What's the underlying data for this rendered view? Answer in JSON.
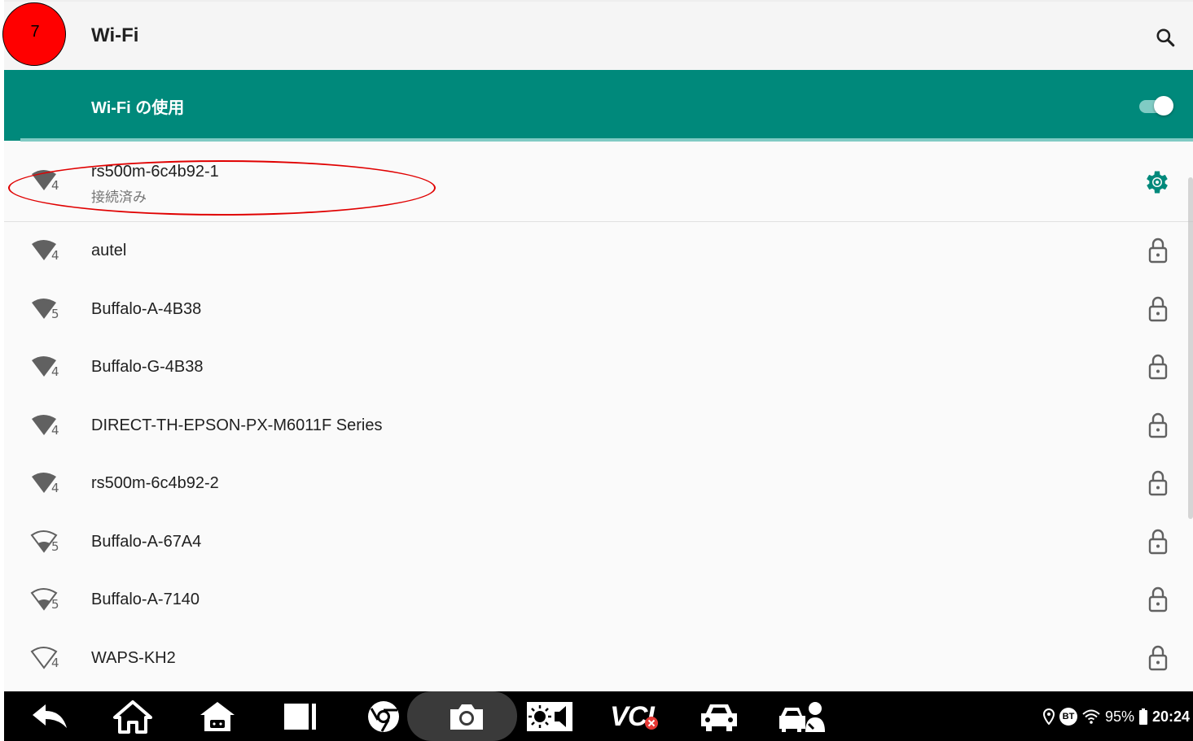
{
  "annotation": {
    "step_number": "7"
  },
  "appbar": {
    "title": "Wi-Fi",
    "search_icon": "search-icon"
  },
  "master_switch": {
    "label": "Wi-Fi の使用",
    "on": true
  },
  "colors": {
    "accent": "#00897b",
    "toggle_track": "#80cbc4",
    "annotation_red": "#ff0000"
  },
  "connected_network": {
    "ssid": "rs500m-6c4b92-1",
    "status": "接続済み",
    "signal_icon": "wifi-full-icon",
    "band": "4",
    "action_icon": "gear-icon"
  },
  "networks": [
    {
      "ssid": "autel",
      "band": "4",
      "signal": "full",
      "secured": true
    },
    {
      "ssid": "Buffalo-A-4B38",
      "band": "5",
      "signal": "full",
      "secured": true
    },
    {
      "ssid": "Buffalo-G-4B38",
      "band": "4",
      "signal": "full",
      "secured": true
    },
    {
      "ssid": "DIRECT-TH-EPSON-PX-M6011F Series",
      "band": "4",
      "signal": "full",
      "secured": true
    },
    {
      "ssid": "rs500m-6c4b92-2",
      "band": "4",
      "signal": "full",
      "secured": true
    },
    {
      "ssid": "Buffalo-A-67A4",
      "band": "5",
      "signal": "low",
      "secured": true
    },
    {
      "ssid": "Buffalo-A-7140",
      "band": "5",
      "signal": "low",
      "secured": true
    },
    {
      "ssid": "WAPS-KH2",
      "band": "4",
      "signal": "none",
      "secured": true
    }
  ],
  "navbar": {
    "items": [
      "back-icon",
      "home-icon",
      "android-home-icon",
      "recents-icon",
      "chrome-icon",
      "camera-icon",
      "brightness-icon",
      "vci-icon",
      "car-icon",
      "car-service-icon"
    ],
    "vci_label": "VCI"
  },
  "status_bar": {
    "location_icon": "location-icon",
    "bt_label": "BT",
    "wifi_icon": "wifi-status-icon",
    "battery": "95%",
    "time": "20:24"
  }
}
